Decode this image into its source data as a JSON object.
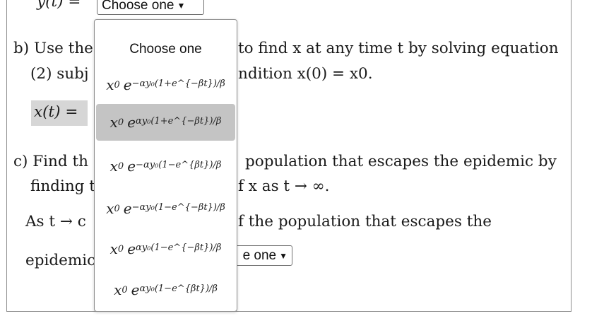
{
  "top_line": {
    "label": "y(t) =",
    "select_value": "Choose one"
  },
  "part_b": {
    "line1_left": "b) Use the",
    "line1_right": "to find x at any time t by solving equation",
    "line2_left": "(2) subj",
    "line2_right": "ndition x(0) = x0.",
    "answer_label": "x(t) ="
  },
  "part_c": {
    "line1_left": "c) Find th",
    "line1_right": "population that escapes the epidemic by",
    "line2_left": "finding t",
    "line2_right": "f x as t → ∞.",
    "line3_left": "As t → c",
    "line3_right": "f the population that escapes the",
    "line4_left": "epidemic",
    "select_partial": "e one"
  },
  "dropdown": {
    "header": "Choose one",
    "options": [
      {
        "base": "x",
        "sub": "0",
        "e": "e",
        "exp": "−αy₀(1+e^{−βt})/β"
      },
      {
        "base": "x",
        "sub": "0",
        "e": "e",
        "exp": "αy₀(1+e^{−βt})/β"
      },
      {
        "base": "x",
        "sub": "0",
        "e": "e",
        "exp": "−αy₀(1−e^{βt})/β"
      },
      {
        "base": "x",
        "sub": "0",
        "e": "e",
        "exp": "−αy₀(1−e^{−βt})/β"
      },
      {
        "base": "x",
        "sub": "0",
        "e": "e",
        "exp": "αy₀(1−e^{−βt})/β"
      },
      {
        "base": "x",
        "sub": "0",
        "e": "e",
        "exp": "αy₀(1−e^{βt})/β"
      }
    ],
    "selected_index": 1
  }
}
